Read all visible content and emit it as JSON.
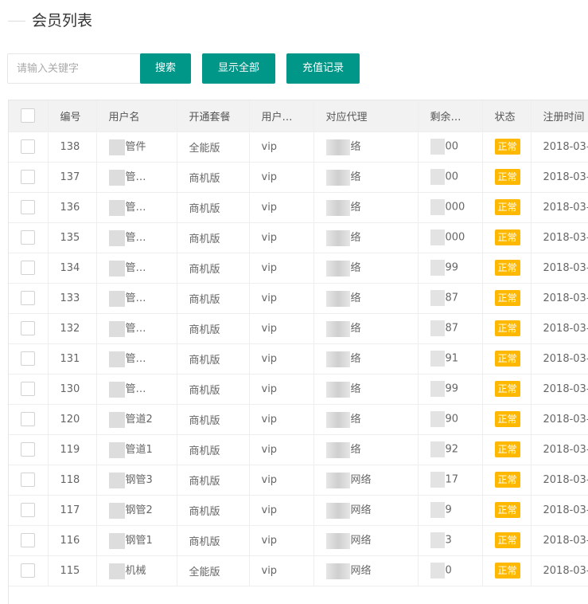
{
  "page": {
    "title": "会员列表"
  },
  "toolbar": {
    "search_placeholder": "请输入关键字",
    "search_label": "搜索",
    "show_all_label": "显示全部",
    "recharge_label": "充值记录"
  },
  "table": {
    "headers": [
      "编号",
      "用户名",
      "开通套餐",
      "用户…",
      "对应代理",
      "剩余…",
      "状态",
      "注册时间"
    ],
    "rows": [
      {
        "id": "138",
        "username": "管件",
        "plan": "全能版",
        "type": "vip",
        "agent": "络",
        "balance": "00",
        "status": "正常",
        "date": "2018-03-"
      },
      {
        "id": "137",
        "username": "管…",
        "plan": "商机版",
        "type": "vip",
        "agent": "络",
        "balance": "00",
        "status": "正常",
        "date": "2018-03-"
      },
      {
        "id": "136",
        "username": "管…",
        "plan": "商机版",
        "type": "vip",
        "agent": "络",
        "balance": "000",
        "status": "正常",
        "date": "2018-03-"
      },
      {
        "id": "135",
        "username": "管…",
        "plan": "商机版",
        "type": "vip",
        "agent": "络",
        "balance": "000",
        "status": "正常",
        "date": "2018-03-"
      },
      {
        "id": "134",
        "username": "管…",
        "plan": "商机版",
        "type": "vip",
        "agent": "络",
        "balance": "99",
        "status": "正常",
        "date": "2018-03-"
      },
      {
        "id": "133",
        "username": "管…",
        "plan": "商机版",
        "type": "vip",
        "agent": "络",
        "balance": "87",
        "status": "正常",
        "date": "2018-03-"
      },
      {
        "id": "132",
        "username": "管…",
        "plan": "商机版",
        "type": "vip",
        "agent": "络",
        "balance": "87",
        "status": "正常",
        "date": "2018-03-"
      },
      {
        "id": "131",
        "username": "管…",
        "plan": "商机版",
        "type": "vip",
        "agent": "络",
        "balance": "91",
        "status": "正常",
        "date": "2018-03-"
      },
      {
        "id": "130",
        "username": "管…",
        "plan": "商机版",
        "type": "vip",
        "agent": "络",
        "balance": "99",
        "status": "正常",
        "date": "2018-03-"
      },
      {
        "id": "120",
        "username": "管道2",
        "plan": "商机版",
        "type": "vip",
        "agent": "络",
        "balance": "90",
        "status": "正常",
        "date": "2018-03-"
      },
      {
        "id": "119",
        "username": "管道1",
        "plan": "商机版",
        "type": "vip",
        "agent": "络",
        "balance": "92",
        "status": "正常",
        "date": "2018-03-"
      },
      {
        "id": "118",
        "username": "钢管3",
        "plan": "商机版",
        "type": "vip",
        "agent": "网络",
        "balance": "17",
        "status": "正常",
        "date": "2018-03-"
      },
      {
        "id": "117",
        "username": "钢管2",
        "plan": "商机版",
        "type": "vip",
        "agent": "网络",
        "balance": "9",
        "status": "正常",
        "date": "2018-03-"
      },
      {
        "id": "116",
        "username": "钢管1",
        "plan": "商机版",
        "type": "vip",
        "agent": "网络",
        "balance": "3",
        "status": "正常",
        "date": "2018-03-"
      },
      {
        "id": "115",
        "username": "机械",
        "plan": "全能版",
        "type": "vip",
        "agent": "网络",
        "balance": "0",
        "status": "正常",
        "date": "2018-03-"
      }
    ]
  },
  "colors": {
    "primary": "#009688",
    "status": "#ffb800",
    "header_bg": "#f2f2f2"
  }
}
